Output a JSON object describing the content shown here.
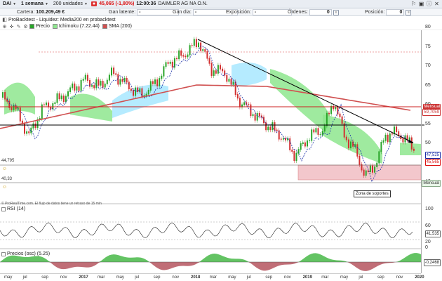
{
  "toolbar": {
    "ticker": "DAI",
    "period": "1 semana",
    "units": "200 unidades",
    "price": "45,065 (-1,80%)",
    "time": "12:00:36",
    "company": "DAIMLER AG NA O.N."
  },
  "account": {
    "cartera_label": "Cartera:",
    "cartera_value": "100.209,49 €",
    "gan_latente_label": "Gan latente:",
    "gan_latente_value": "-",
    "gan_dia_label": "Gan día:",
    "gan_dia_value": "-",
    "exposicion_label": "Exposición:",
    "exposicion_value": "-",
    "ordenes_label": "Órdenes:",
    "ordenes_value": "0",
    "posicion_label": "Posición:",
    "posicion_value": "0"
  },
  "indicators_row1": {
    "probacktest": "ProBacktest - Liquidez: Media200 en probacktest"
  },
  "indicators_row2": {
    "precio": "Precio",
    "ichimoku": "Ichimoku (7.22.44)",
    "sma": "SMA (200)"
  },
  "main_axis": {
    "ticks": [
      "80",
      "75",
      "70",
      "65",
      "60",
      "55",
      "50",
      "45",
      "40"
    ],
    "tags": {
      "mensual_top": "Mensual",
      "sma_val": "59,7059",
      "price_blue": "47,525",
      "price_red": "45,565",
      "mensual_bottom": "Mensual"
    },
    "left_labels": {
      "upper": "44,795",
      "lower": "40,33"
    }
  },
  "annotation": "Zona de soportes",
  "note": "© ProRealTime.com. El flujo de datos tiene un retraso de 15 min",
  "rsi": {
    "title": "RSI (14)",
    "ticks": [
      "100",
      "60",
      "20",
      "0"
    ],
    "value": "41,535"
  },
  "osc": {
    "title": "Precios (osc) (5.25)",
    "value": "-0,2468"
  },
  "xaxis": [
    {
      "label": "may",
      "year": false
    },
    {
      "label": "jul",
      "year": false
    },
    {
      "label": "sep",
      "year": false
    },
    {
      "label": "nov",
      "year": false
    },
    {
      "label": "2017",
      "year": true
    },
    {
      "label": "mar",
      "year": false
    },
    {
      "label": "may",
      "year": false
    },
    {
      "label": "jul",
      "year": false
    },
    {
      "label": "sep",
      "year": false
    },
    {
      "label": "nov",
      "year": false
    },
    {
      "label": "2018",
      "year": true
    },
    {
      "label": "mar",
      "year": false
    },
    {
      "label": "may",
      "year": false
    },
    {
      "label": "jul",
      "year": false
    },
    {
      "label": "sep",
      "year": false
    },
    {
      "label": "nov",
      "year": false
    },
    {
      "label": "2019",
      "year": true
    },
    {
      "label": "mar",
      "year": false
    },
    {
      "label": "may",
      "year": false
    },
    {
      "label": "jul",
      "year": false
    },
    {
      "label": "sep",
      "year": false
    },
    {
      "label": "nov",
      "year": false
    },
    {
      "label": "2020",
      "year": true
    }
  ],
  "colors": {
    "up": "#2aa52a",
    "down": "#d23030",
    "sma": "#d05050",
    "cloud_green": "#8ee68e",
    "cloud_blue": "#a8e8ff",
    "kijun": "#1a2fa8",
    "support_zone": "#f3c7cc"
  },
  "icons": {
    "toolbar": [
      "chevron-down-icon",
      "bell-icon",
      "camera-icon",
      "info-icon",
      "close-icon"
    ]
  }
}
